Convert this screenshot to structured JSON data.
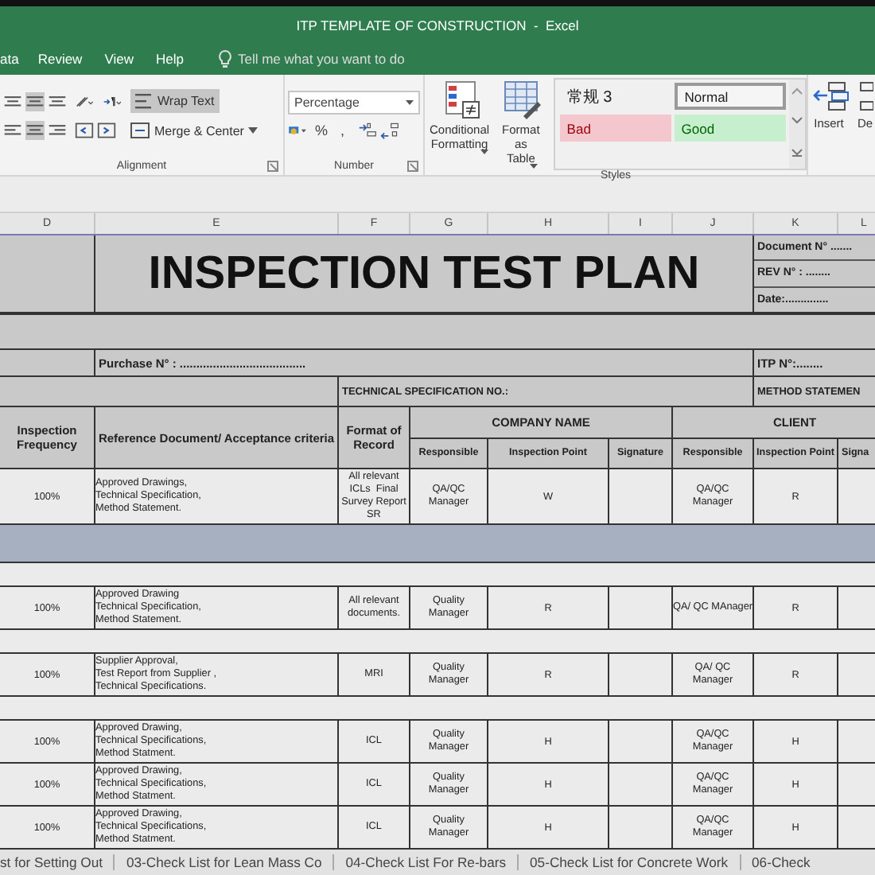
{
  "window": {
    "title": "ITP TEMPLATE OF CONSTRUCTION  -  Excel"
  },
  "menu": [
    {
      "label": "ata",
      "selected": false
    },
    {
      "label": "Review",
      "selected": false
    },
    {
      "label": "View",
      "selected": false
    },
    {
      "label": "Help",
      "selected": false
    }
  ],
  "tell_me": {
    "placeholder": "Tell me what you want to do"
  },
  "ribbon": {
    "alignment": {
      "label": "Alignment",
      "wrap_text": {
        "label": "Wrap Text",
        "on": true
      },
      "merge": "Merge & Center"
    },
    "number": {
      "label": "Number",
      "format": "Percentage",
      "percent": "%",
      "comma": ","
    },
    "styles": {
      "label": "Styles",
      "conditional": "Conditional Formatting",
      "format_table": "Format as Table",
      "gallery": [
        {
          "label": "常规 3",
          "kind": "plain"
        },
        {
          "label": "Normal",
          "kind": "normal"
        },
        {
          "label": "Bad",
          "kind": "bad"
        },
        {
          "label": "Good",
          "kind": "good"
        }
      ]
    },
    "cells": {
      "insert": "Insert",
      "delete": "De"
    }
  },
  "column_headers": [
    "D",
    "E",
    "F",
    "G",
    "H",
    "I",
    "J",
    "K",
    "L"
  ],
  "sheet": {
    "title": "INSPECTION TEST PLAN",
    "doc_fields": [
      "Document N° .......",
      "REV N° :  ........",
      "Date:.............."
    ],
    "purchase": "Purchase N° : ......................................",
    "itp_no": "ITP N°:........",
    "tech_spec": "TECHNICAL SPECIFICATION NO.:",
    "method": "METHOD STATEMEN",
    "headers": {
      "frequency": "Inspection Frequency",
      "reference": "Reference Document/ Acceptance criteria",
      "format": "Format of Record",
      "company": {
        "label": "COMPANY NAME",
        "columns": [
          "Responsible",
          "Inspection Point",
          "Signature"
        ]
      },
      "client": {
        "label": "CLIENT",
        "columns": [
          "Responsible",
          "Inspection Point",
          "Signa"
        ]
      }
    },
    "rows": [
      {
        "kind": "data",
        "frequency": "100%",
        "reference": "Approved Drawings,\nTechnical Specification,\nMethod Statement.",
        "format": "All relevant\nICLs  Final\nSurvey Report\nSR",
        "company_responsible": "QA/QC\nManager",
        "company_point": "W",
        "client_responsible": "QA/QC\nManager",
        "client_point": "R"
      },
      {
        "kind": "band"
      },
      {
        "kind": "blank"
      },
      {
        "kind": "data",
        "frequency": "100%",
        "reference": "Approved Drawing\nTechnical Specification,\nMethod Statement.",
        "format": "All relevant\ndocuments.",
        "company_responsible": "Quality\nManager",
        "company_point": "R",
        "client_responsible": "QA/ QC MAnager",
        "client_point": "R"
      },
      {
        "kind": "blank"
      },
      {
        "kind": "data",
        "frequency": "100%",
        "reference": "Supplier Approval,\nTest Report from Supplier ,\nTechnical Specifications.",
        "format": "MRI",
        "company_responsible": "Quality\nManager",
        "company_point": "R",
        "client_responsible": "QA/ QC\nManager",
        "client_point": "R"
      },
      {
        "kind": "blank"
      },
      {
        "kind": "data",
        "frequency": "100%",
        "reference": "Approved Drawing,\nTechnical Specifications,\nMethod Statment.",
        "format": "ICL",
        "company_responsible": "Quality\nManager",
        "company_point": "H",
        "client_responsible": "QA/QC\nManager",
        "client_point": "H"
      },
      {
        "kind": "data",
        "frequency": "100%",
        "reference": "Approved Drawing,\nTechnical Specifications,\nMethod Statment.",
        "format": "ICL",
        "company_responsible": "Quality\nManager",
        "company_point": "H",
        "client_responsible": "QA/QC\nManager",
        "client_point": "H"
      },
      {
        "kind": "data",
        "frequency": "100%",
        "reference": "Approved Drawing,\nTechnical Specifications,\nMethod Statment.",
        "format": "ICL",
        "company_responsible": "Quality\nManager",
        "company_point": "H",
        "client_responsible": "QA/QC\nManager",
        "client_point": "H"
      }
    ]
  },
  "sheet_tabs": [
    {
      "label": "st for Setting Out",
      "selected": false
    },
    {
      "label": "03-Check List for Lean Mass Co",
      "selected": false
    },
    {
      "label": "04-Check List For Re-bars",
      "selected": false
    },
    {
      "label": "05-Check List for Concrete Work",
      "selected": false
    },
    {
      "label": "06-Check",
      "selected": false
    }
  ]
}
